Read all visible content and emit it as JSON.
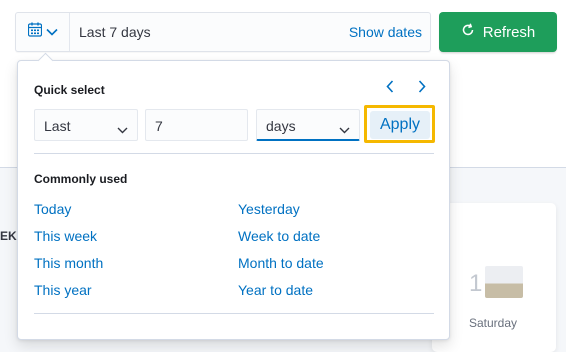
{
  "date_picker": {
    "range_label": "Last 7 days",
    "show_dates_label": "Show dates"
  },
  "refresh": {
    "label": "Refresh"
  },
  "quick_select": {
    "title": "Quick select",
    "direction": "Last",
    "value": "7",
    "unit": "days",
    "apply_label": "Apply"
  },
  "commonly_used": {
    "title": "Commonly used",
    "left": [
      "Today",
      "This week",
      "This month",
      "This year"
    ],
    "right": [
      "Yesterday",
      "Week to date",
      "Month to date",
      "Year to date"
    ]
  },
  "background": {
    "partial_text": "EK",
    "card_digit": "1",
    "card_day": "Saturday"
  },
  "colors": {
    "accent": "#0071c2",
    "refresh_green": "#1e9e5b",
    "highlight": "#f5b800"
  },
  "icons": [
    "calendar-icon",
    "chevron-down-icon",
    "refresh-icon",
    "chevron-left-icon",
    "chevron-right-icon"
  ]
}
